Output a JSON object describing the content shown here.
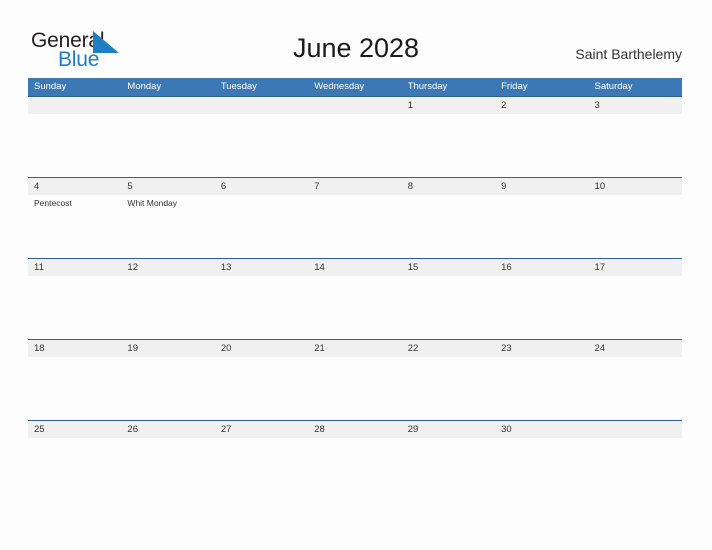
{
  "brand": {
    "logo_part1": "General",
    "logo_part2": "Blue",
    "flag_icon": "blue-triangle-flag-icon",
    "logo_color_dark": "#231f20",
    "logo_color_blue": "#1f7fc4"
  },
  "header": {
    "title": "June 2028",
    "region": "Saint Barthelemy"
  },
  "theme": {
    "header_blue": "#3b78b5",
    "row_border_blue": "#2e6095",
    "day_band_gray": "#f0f0f0",
    "page_background": "#fdfdfd",
    "text_dark": "#333333"
  },
  "calendar": {
    "weekdays": [
      "Sunday",
      "Monday",
      "Tuesday",
      "Wednesday",
      "Thursday",
      "Friday",
      "Saturday"
    ],
    "weeks": [
      {
        "days": [
          {
            "date": "",
            "events": []
          },
          {
            "date": "",
            "events": []
          },
          {
            "date": "",
            "events": []
          },
          {
            "date": "",
            "events": []
          },
          {
            "date": "1",
            "events": []
          },
          {
            "date": "2",
            "events": []
          },
          {
            "date": "3",
            "events": []
          }
        ]
      },
      {
        "days": [
          {
            "date": "4",
            "events": [
              "Pentecost"
            ]
          },
          {
            "date": "5",
            "events": [
              "Whit Monday"
            ]
          },
          {
            "date": "6",
            "events": []
          },
          {
            "date": "7",
            "events": []
          },
          {
            "date": "8",
            "events": []
          },
          {
            "date": "9",
            "events": []
          },
          {
            "date": "10",
            "events": []
          }
        ]
      },
      {
        "days": [
          {
            "date": "11",
            "events": []
          },
          {
            "date": "12",
            "events": []
          },
          {
            "date": "13",
            "events": []
          },
          {
            "date": "14",
            "events": []
          },
          {
            "date": "15",
            "events": []
          },
          {
            "date": "16",
            "events": []
          },
          {
            "date": "17",
            "events": []
          }
        ]
      },
      {
        "days": [
          {
            "date": "18",
            "events": []
          },
          {
            "date": "19",
            "events": []
          },
          {
            "date": "20",
            "events": []
          },
          {
            "date": "21",
            "events": []
          },
          {
            "date": "22",
            "events": []
          },
          {
            "date": "23",
            "events": []
          },
          {
            "date": "24",
            "events": []
          }
        ]
      },
      {
        "days": [
          {
            "date": "25",
            "events": []
          },
          {
            "date": "26",
            "events": []
          },
          {
            "date": "27",
            "events": []
          },
          {
            "date": "28",
            "events": []
          },
          {
            "date": "29",
            "events": []
          },
          {
            "date": "30",
            "events": []
          },
          {
            "date": "",
            "events": []
          }
        ]
      }
    ]
  }
}
